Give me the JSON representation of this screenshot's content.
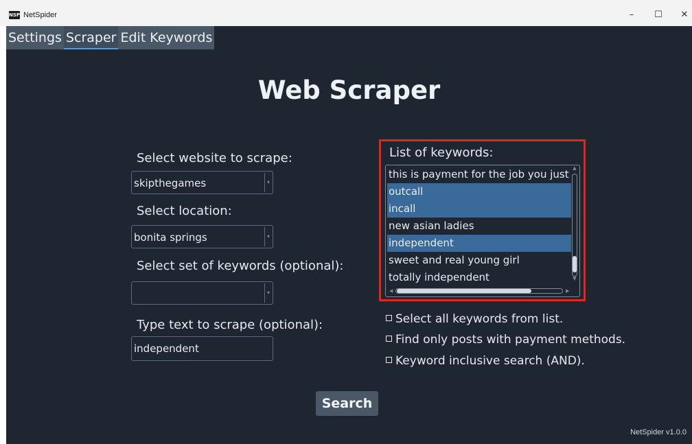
{
  "window": {
    "icon_text": "NSP",
    "title": "NetSpider",
    "minimize": "–",
    "maximize": "☐",
    "close": "✕"
  },
  "tabs": [
    {
      "label": "Settings",
      "active": false
    },
    {
      "label": "Scraper",
      "active": true
    },
    {
      "label": "Edit Keywords",
      "active": false
    }
  ],
  "main": {
    "heading": "Web Scraper",
    "website_label": "Select website to scrape:",
    "website_value": "skipthegames",
    "location_label": "Select location:",
    "location_value": "bonita springs",
    "keyword_set_label": "Select set of keywords (optional):",
    "keyword_set_value": "",
    "text_label": "Type text to scrape (optional):",
    "text_value": "independent"
  },
  "keywords": {
    "title": "List of keywords:",
    "items": [
      {
        "text": "this is payment for the job you just",
        "selected": false
      },
      {
        "text": "outcall",
        "selected": true
      },
      {
        "text": "incall",
        "selected": true
      },
      {
        "text": "new asian ladies",
        "selected": false
      },
      {
        "text": "independent",
        "selected": true
      },
      {
        "text": "sweet and real young girl",
        "selected": false
      },
      {
        "text": "totally independent",
        "selected": false
      }
    ]
  },
  "options": {
    "select_all": "Select all keywords from list.",
    "payment_only": "Find only posts with payment methods.",
    "inclusive": "Keyword inclusive search (AND)."
  },
  "search_label": "Search",
  "version": "NetSpider v1.0.0",
  "colors": {
    "background": "#1e2631",
    "tab": "#4a5766",
    "selection": "#3a6a9a",
    "highlight_frame": "#e8241a",
    "tab_underline": "#4ea1e0"
  }
}
